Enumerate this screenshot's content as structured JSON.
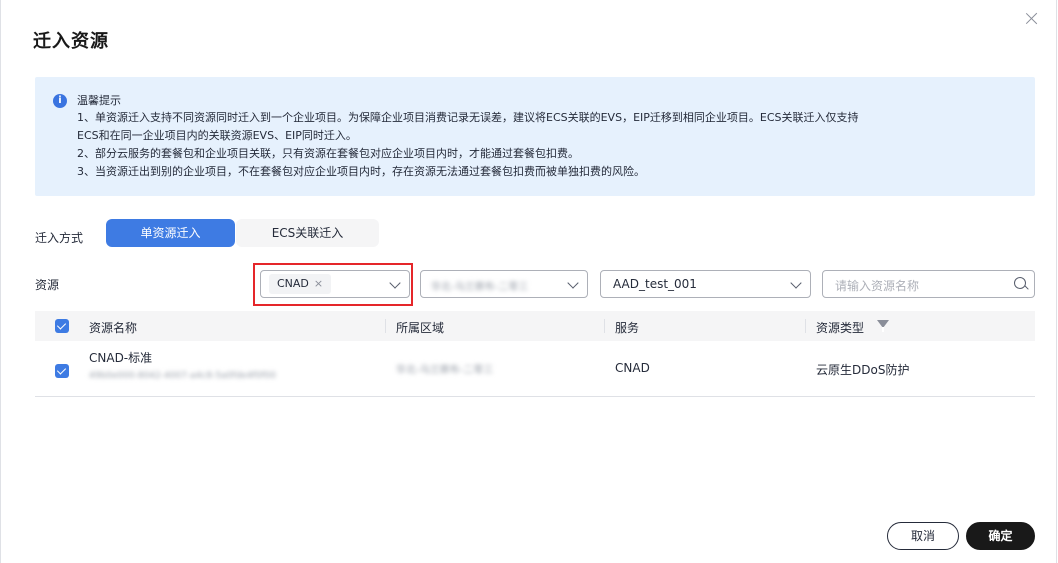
{
  "dialog": {
    "title": "迁入资源",
    "close_icon": "close-icon"
  },
  "notice": {
    "icon": "info-icon",
    "icon_glyph": "i",
    "title": "温馨提示",
    "lines": [
      "1、单资源迁入支持不同资源同时迁入到一个企业项目。为保障企业项目消费记录无误差，建议将ECS关联的EVS，EIP迁移到相同企业项目。ECS关联迁入仅支持",
      "ECS和在同一企业项目内的关联资源EVS、EIP同时迁入。",
      "2、部分云服务的套餐包和企业项目关联，只有资源在套餐包对应企业项目内时，才能通过套餐包扣费。",
      "3、当资源迁出到别的企业项目，不在套餐包对应企业项目内时，存在资源无法通过套餐包扣费而被单独扣费的风险。"
    ]
  },
  "mode": {
    "label": "迁入方式",
    "options": [
      "单资源迁入",
      "ECS关联迁入"
    ],
    "selected": "单资源迁入"
  },
  "filters": {
    "label": "资源",
    "service_tag": "CNAD",
    "service_tag_remove": "×",
    "region_value": "华北-乌兰察布-二零三",
    "enterprise_project": "AAD_test_001",
    "search_placeholder": "请输入资源名称"
  },
  "table": {
    "columns": [
      "资源名称",
      "所属区域",
      "服务",
      "资源类型"
    ],
    "rows": [
      {
        "checked": true,
        "name": "CNAD-标准",
        "id": "49b0e000-8042-4007-a4c8-5a0fde4f0f00",
        "region": "华北-乌兰察布-二零三",
        "service": "CNAD",
        "type": "云原生DDoS防护"
      }
    ]
  },
  "footer": {
    "cancel_label": "取消",
    "ok_label": "确定"
  },
  "colors": {
    "accent": "#3e7be3",
    "notice_bg": "#e6f1fd",
    "highlight": "#e5262a",
    "primary_button": "#191919"
  }
}
